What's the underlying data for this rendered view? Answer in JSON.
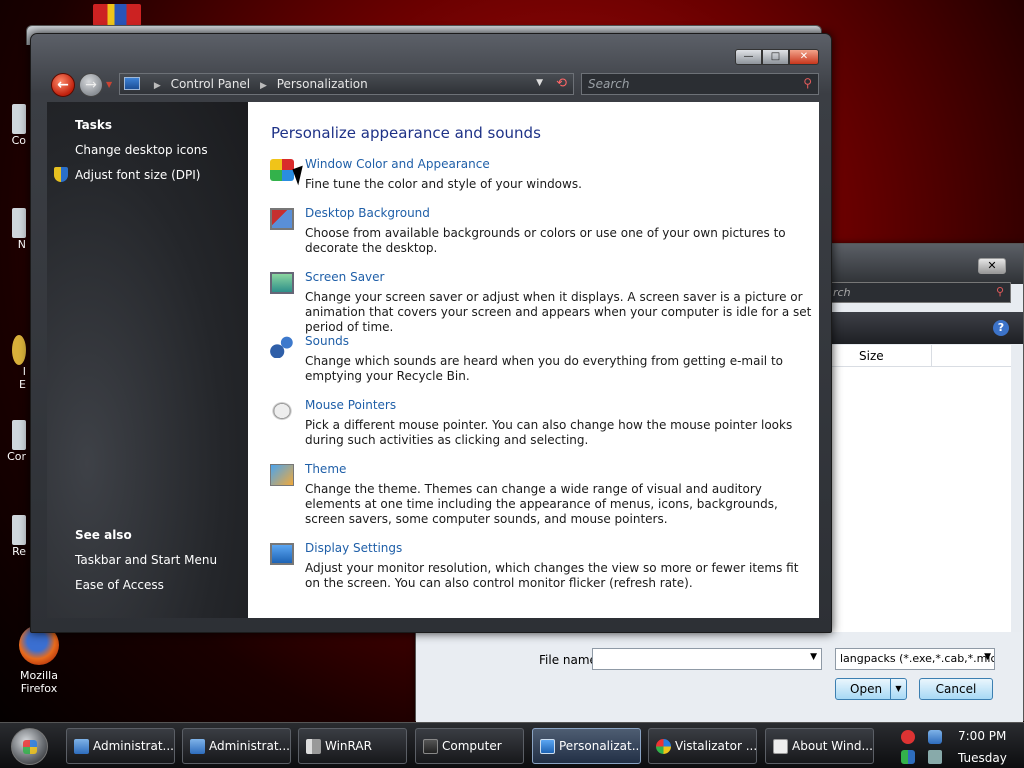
{
  "desktop": {
    "icons": [
      {
        "label_line1": "Mozilla",
        "label_line2": "Firefox"
      }
    ],
    "stubs": [
      "Co",
      "N",
      "I",
      "E",
      "Cor",
      "Re"
    ]
  },
  "file_dialog": {
    "search_placeholder": "rch",
    "column_size": "Size",
    "file_name_label": "File name:",
    "file_name_value": "",
    "file_type": "langpacks (*.exe,*.cab,*.mlc)",
    "open_label": "Open",
    "cancel_label": "Cancel",
    "close_glyph": "✕"
  },
  "window": {
    "breadcrumb": [
      "Control Panel",
      "Personalization"
    ],
    "search_placeholder": "Search",
    "controls": {
      "min": "—",
      "max": "□",
      "close": "✕"
    }
  },
  "sidebar": {
    "tasks_heading": "Tasks",
    "tasks": [
      "Change desktop icons",
      "Adjust font size (DPI)"
    ],
    "see_also_heading": "See also",
    "see_also": [
      "Taskbar and Start Menu",
      "Ease of Access"
    ]
  },
  "content": {
    "title": "Personalize appearance and sounds",
    "items": [
      {
        "icon": "color-appearance-icon",
        "title": "Window Color and Appearance",
        "desc": "Fine tune the color and style of your windows."
      },
      {
        "icon": "desktop-background-icon",
        "title": "Desktop Background",
        "desc": "Choose from available backgrounds or colors or use one of your own pictures to decorate the desktop."
      },
      {
        "icon": "screen-saver-icon",
        "title": "Screen Saver",
        "desc": "Change your screen saver or adjust when it displays. A screen saver is a picture or animation that covers your screen and appears when your computer is idle for a set period of time."
      },
      {
        "icon": "sounds-icon",
        "title": "Sounds",
        "desc": "Change which sounds are heard when you do everything from getting e-mail to emptying your Recycle Bin."
      },
      {
        "icon": "mouse-pointers-icon",
        "title": "Mouse Pointers",
        "desc": "Pick a different mouse pointer. You can also change how the mouse pointer looks during such activities as clicking and selecting."
      },
      {
        "icon": "theme-icon",
        "title": "Theme",
        "desc": "Change the theme. Themes can change a wide range of visual and auditory elements at one time including the appearance of menus, icons, backgrounds, screen savers, some computer sounds, and mouse pointers."
      },
      {
        "icon": "display-settings-icon",
        "title": "Display Settings",
        "desc": "Adjust your monitor resolution, which changes the view so more or fewer items fit on the screen. You can also control monitor flicker (refresh rate)."
      }
    ]
  },
  "taskbar": {
    "buttons": [
      {
        "label": "Administrat...",
        "icon": "admin-icon",
        "active": false
      },
      {
        "label": "Administrat...",
        "icon": "admin-icon",
        "active": false
      },
      {
        "label": "WinRAR",
        "icon": "winrar-icon",
        "active": false
      },
      {
        "label": "Computer",
        "icon": "computer-icon",
        "active": false
      },
      {
        "label": "Personalizat...",
        "icon": "personalization-icon",
        "active": true
      },
      {
        "label": "Vistalizator ...",
        "icon": "vistalizator-icon",
        "active": false
      },
      {
        "label": "About Wind...",
        "icon": "about-windows-icon",
        "active": false
      }
    ],
    "clock_time": "7:00 PM",
    "clock_day": "Tuesday"
  },
  "colors": {
    "link": "#1f5fa8",
    "title": "#1e3287",
    "accent_red": "#c0210d"
  }
}
